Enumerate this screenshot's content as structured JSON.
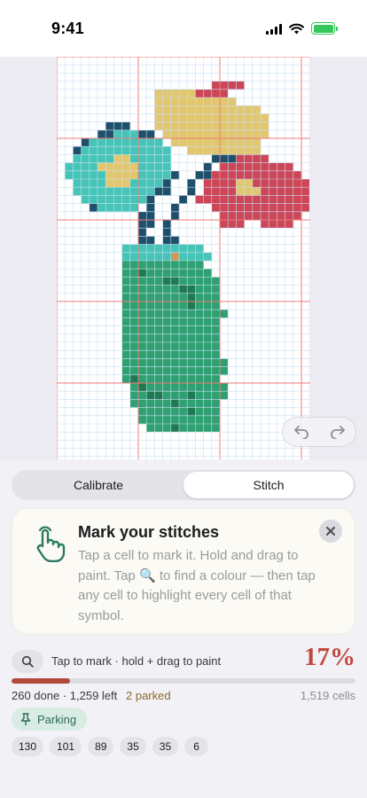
{
  "status": {
    "time": "9:41",
    "colors": {
      "battery": "#34c759"
    }
  },
  "canvas": {
    "palette": {
      "t": "#45c4b7",
      "y": "#e2c76f",
      "r": "#cc4658",
      "n": "#1f4f6a",
      "g": "#2fa072",
      "d": "#1f7a52",
      "b": "#c79a5e"
    },
    "pattern": [
      ".................................",
      ".................................",
      "................................",
      "...................rrrr..........",
      "............yyyyyrrrr............",
      "............yyyyyyyyyy...........",
      "............yyyyyyyyyyyyy........",
      "............yyyyyyyyyyyyyy.......",
      "......nnn...yyyyyyyyyyyyyy.......",
      ".....nntttnn.yyyyyyyyyyyyy.......",
      "...nttttttttt.yyyyyyyyyyy........",
      "..nttttttttttt..yyyyyyyyy........",
      "..tttttyyttttt.....nnnrrrr.......",
      ".ttttyyyyytttt....n.rrrrrrrrr....",
      ".tttttyyyyttttn..nnrrrrrrrrrrr...",
      "..ttttyyyttttn..n.rrrryyrrrrrrr..",
      "..ttttttttttnn..n.rrrryyyrrrrrrr.",
      "...ttttttttn...n.rrrrrrrrrrrrrrr.",
      "....nttttt.n..n....rrrrrrrrrrrr..",
      "..........nn..n.....rrrrrrrrrr...",
      "..........nn.n......rrr..rrrr....",
      "..........n..n...................",
      "..........nn.nn..................",
      "........tttttttttt...............",
      "........ttttttbtttt..............",
      "........gggggggggg...............",
      "........ggdgggggggg..............",
      "........gggggddggggg.............",
      "........gggggggddggg.............",
      "........ggggggggdggg.............",
      "........ggggggggdggg.............",
      "........ggggggggggggg............",
      "........gggggggggggg.............",
      "........gggggggggggg.............",
      "........gggggggggggg.............",
      "........gggggggggggg.............",
      "........gggggggggggg.............",
      "........ggggggggggggg............",
      "........ggggggggggggg............",
      "........gdgggggggggg.............",
      ".........gdgggggggggg............",
      ".........ggddgggdgggg............",
      ".........gggggdggggg.............",
      "..........ggggggdggg.............",
      "..........gggggggggg.............",
      "...........gggdggggg.............",
      "..........................."
    ]
  },
  "history": {
    "undo_icon": "undo-arrow-icon",
    "redo_icon": "redo-arrow-icon"
  },
  "modes": {
    "calibrate": "Calibrate",
    "stitch": "Stitch"
  },
  "tip": {
    "title": "Mark your stitches",
    "body_before": "Tap a cell to mark it. Hold and drag to paint. Tap",
    "body_icon": "🔍",
    "body_after": "to find a colour — then tap any cell to highlight every cell of that symbol.",
    "icon": "tap-hand-icon"
  },
  "hint": {
    "text": "Tap to mark · hold + drag to paint",
    "percent": "17%"
  },
  "progress": {
    "fraction": 0.17
  },
  "stats": {
    "done_left": "260 done · 1,259 left",
    "parked": "2 parked",
    "cells": "1,519 cells"
  },
  "parking": {
    "label": "Parking"
  },
  "counts": [
    "130",
    "101",
    "89",
    "35",
    "35",
    "6"
  ]
}
